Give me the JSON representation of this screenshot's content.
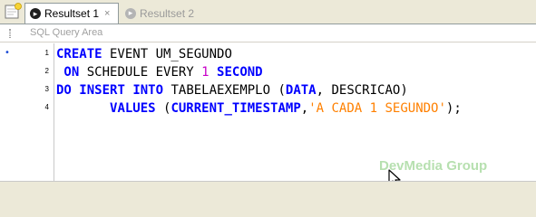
{
  "tabs": [
    {
      "label": "Resultset 1",
      "close": "×",
      "icon": "resultset-icon",
      "active": true
    },
    {
      "label": "Resultset 2",
      "icon": "resultset-icon",
      "active": false
    }
  ],
  "editor": {
    "area_label": "SQL Query Area",
    "line_numbers": [
      "1",
      "2",
      "3",
      "4"
    ],
    "lines": [
      [
        {
          "text": "CREATE",
          "kind": "kw"
        },
        {
          "text": " EVENT UM_SEGUNDO",
          "kind": "plain"
        }
      ],
      [
        {
          "text": " ON",
          "kind": "kw"
        },
        {
          "text": " SCHEDULE EVERY ",
          "kind": "plain"
        },
        {
          "text": "1",
          "kind": "num"
        },
        {
          "text": " ",
          "kind": "plain"
        },
        {
          "text": "SECOND",
          "kind": "kw"
        }
      ],
      [
        {
          "text": "DO",
          "kind": "kw"
        },
        {
          "text": " ",
          "kind": "plain"
        },
        {
          "text": "INSERT",
          "kind": "kw"
        },
        {
          "text": " ",
          "kind": "plain"
        },
        {
          "text": "INTO",
          "kind": "kw"
        },
        {
          "text": " TABELAEXEMPLO (",
          "kind": "plain"
        },
        {
          "text": "DATA",
          "kind": "kw"
        },
        {
          "text": ", DESCRICAO)",
          "kind": "plain"
        }
      ],
      [
        {
          "text": "       ",
          "kind": "plain"
        },
        {
          "text": "VALUES",
          "kind": "kw"
        },
        {
          "text": " (",
          "kind": "plain"
        },
        {
          "text": "CURRENT_TIMESTAMP",
          "kind": "kw"
        },
        {
          "text": ",",
          "kind": "plain"
        },
        {
          "text": "'A CADA 1 SEGUNDO'",
          "kind": "str"
        },
        {
          "text": ");",
          "kind": "plain"
        }
      ]
    ]
  },
  "watermark": "DevMedia Group",
  "colors": {
    "keyword": "#0000ff",
    "number": "#c800c8",
    "string": "#ff8000",
    "watermark": "#b7e0b0"
  }
}
